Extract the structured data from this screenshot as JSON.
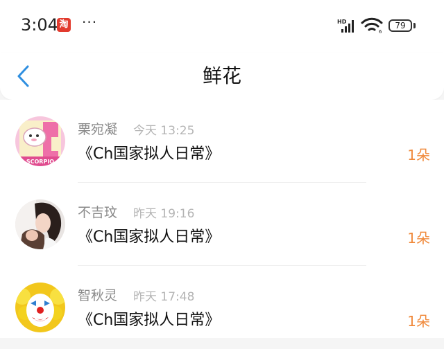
{
  "status_bar": {
    "time": "3:04",
    "app_badge": "淘",
    "more": "···",
    "network": "HD",
    "battery": "79"
  },
  "nav": {
    "title": "鲜花"
  },
  "items": [
    {
      "name": "栗宛凝",
      "time": "今天 13:25",
      "title": "《Ch国家拟人日常》",
      "count": "1朵",
      "avatar_badge": "SCORPIO"
    },
    {
      "name": "不吉玟",
      "time": "昨天 19:16",
      "title": "《Ch国家拟人日常》",
      "count": "1朵"
    },
    {
      "name": "智秋灵",
      "time": "昨天 17:48",
      "title": "《Ch国家拟人日常》",
      "count": "1朵"
    }
  ],
  "colors": {
    "accent": "#f0893a",
    "back_arrow": "#2f8fe0"
  }
}
